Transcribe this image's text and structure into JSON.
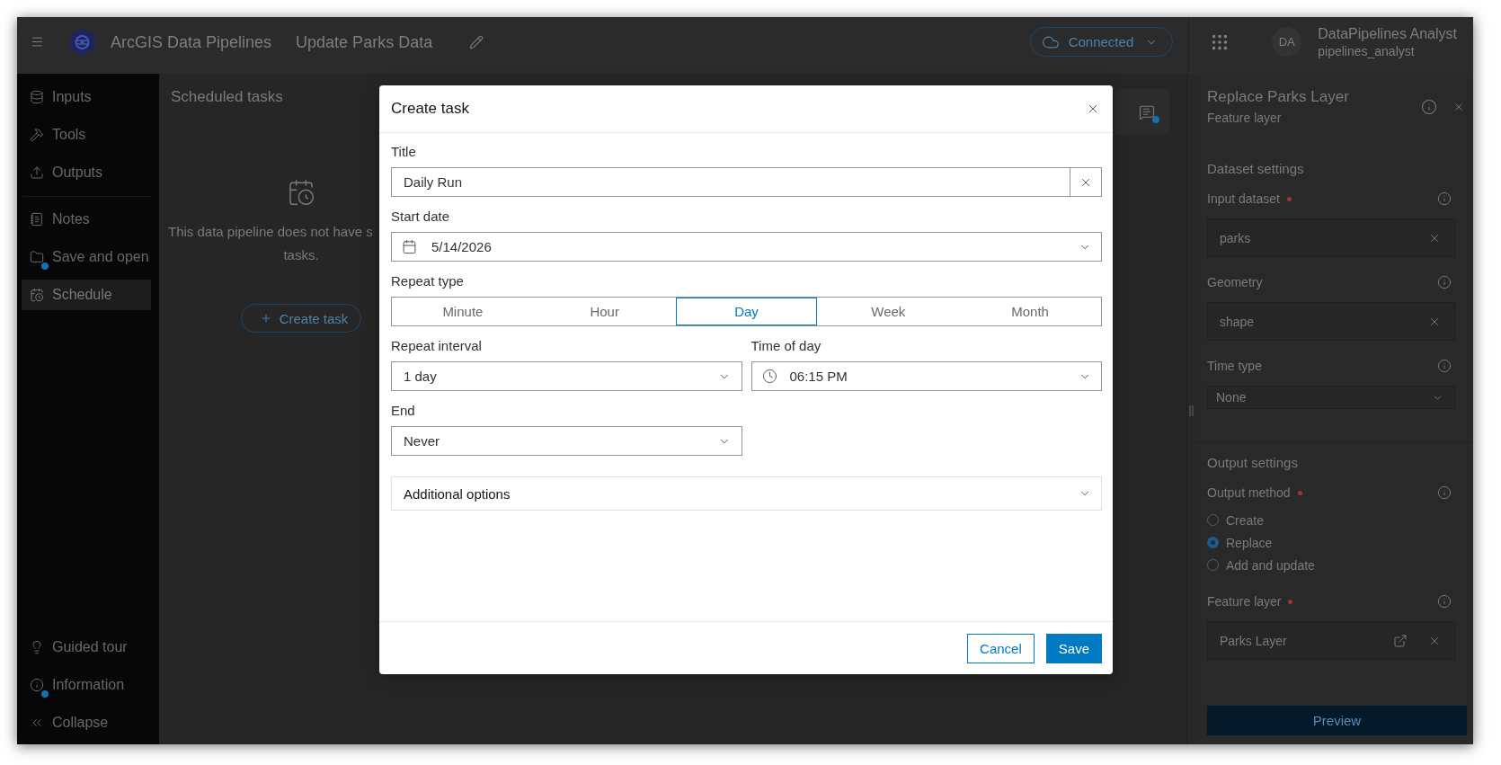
{
  "top_bar": {
    "app_name": "ArcGIS Data Pipelines",
    "pipeline_name": "Update Parks Data",
    "connection": {
      "label": "Connected"
    },
    "user": {
      "initials": "DA",
      "name": "DataPipelines Analyst",
      "username": "pipelines_analyst"
    }
  },
  "sidebar": {
    "groups": [
      [
        {
          "label": "Inputs",
          "selected": false,
          "badge": false
        },
        {
          "label": "Tools",
          "selected": false,
          "badge": false
        },
        {
          "label": "Outputs",
          "selected": false,
          "badge": false
        }
      ],
      [
        {
          "label": "Notes",
          "selected": false,
          "badge": false
        },
        {
          "label": "Save and open",
          "selected": false,
          "badge": true
        },
        {
          "label": "Schedule",
          "selected": true,
          "badge": false
        }
      ]
    ],
    "footer_items": [
      {
        "label": "Guided tour",
        "badge": false
      },
      {
        "label": "Information",
        "badge": true
      },
      {
        "label": "Collapse",
        "badge": false
      }
    ]
  },
  "scheduled_tasks": {
    "title": "Scheduled tasks",
    "empty_text": [
      "This data pipeline does not have s",
      "tasks."
    ],
    "create_button": "Create task"
  },
  "canvas_toolbar": {
    "notes_badge": true
  },
  "details_panel": {
    "title": "Replace Parks Layer",
    "subtitle": "Feature layer",
    "sections": [
      {
        "title": "Dataset settings",
        "fields": [
          {
            "kind": "input",
            "label": "Input dataset",
            "required": true,
            "value": "parks"
          },
          {
            "kind": "input",
            "label": "Geometry",
            "required": false,
            "value": "shape"
          },
          {
            "kind": "select",
            "label": "Time type",
            "required": false,
            "value": "None"
          }
        ]
      },
      {
        "title": "Output settings",
        "fields": [
          {
            "kind": "radio",
            "label": "Output method",
            "required": true,
            "options": [
              {
                "label": "Create",
                "selected": false
              },
              {
                "label": "Replace",
                "selected": true
              },
              {
                "label": "Add and update",
                "selected": false
              }
            ]
          },
          {
            "kind": "layer",
            "label": "Feature layer",
            "required": true,
            "value": "Parks Layer"
          }
        ]
      }
    ],
    "action": "Preview"
  },
  "dialog": {
    "title": "Create task",
    "fields": [
      {
        "kind": "text",
        "label": "Title",
        "value": "Daily Run"
      },
      {
        "kind": "date",
        "label": "Start date",
        "value": "5/14/2026"
      },
      {
        "kind": "segmented",
        "label": "Repeat type",
        "options": [
          {
            "label": "Minute",
            "selected": false
          },
          {
            "label": "Hour",
            "selected": false
          },
          {
            "label": "Day",
            "selected": true
          },
          {
            "label": "Week",
            "selected": false
          },
          {
            "label": "Month",
            "selected": false
          }
        ]
      },
      {
        "kind": "select",
        "label": "Repeat interval",
        "value": "1 day"
      },
      {
        "kind": "time",
        "label": "Time of day",
        "value": "06:15 PM"
      },
      {
        "kind": "select",
        "label": "End",
        "value": "Never"
      }
    ],
    "accordion": {
      "label": "Additional options",
      "expanded": false
    },
    "buttons": [
      {
        "label": "Cancel",
        "kind": "secondary"
      },
      {
        "label": "Save",
        "kind": "primary"
      }
    ]
  }
}
